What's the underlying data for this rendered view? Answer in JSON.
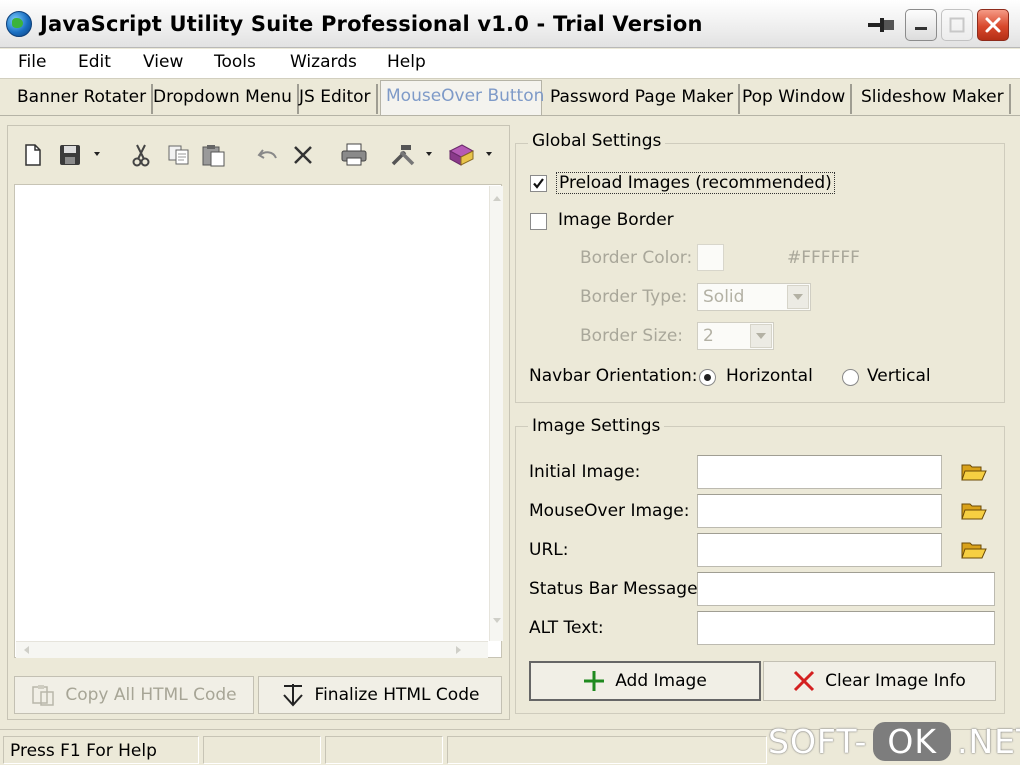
{
  "window": {
    "title": "JavaScript Utility Suite Professional v1.0 - Trial Version"
  },
  "menu": [
    "File",
    "Edit",
    "View",
    "Tools",
    "Wizards",
    "Help"
  ],
  "tabs": [
    {
      "label": "Banner Rotater",
      "active": false
    },
    {
      "label": "Dropdown Menu",
      "active": false
    },
    {
      "label": "JS Editor",
      "active": false
    },
    {
      "label": "MouseOver Button",
      "active": true
    },
    {
      "label": "Password Page Maker",
      "active": false
    },
    {
      "label": "Pop Window",
      "active": false
    },
    {
      "label": "Slideshow Maker",
      "active": false
    }
  ],
  "left": {
    "copy_button": "Copy All HTML Code",
    "finalize_button": "Finalize HTML Code"
  },
  "global_settings": {
    "title": "Global Settings",
    "preload_label": "Preload Images (recommended)",
    "preload_checked": true,
    "border_label": "Image Border",
    "border_checked": false,
    "border_color_label": "Border Color:",
    "border_color_value": "#FFFFFF",
    "border_type_label": "Border Type:",
    "border_type_value": "Solid",
    "border_size_label": "Border Size:",
    "border_size_value": "2",
    "orientation_label": "Navbar Orientation:",
    "orientation_horizontal": "Horizontal",
    "orientation_vertical": "Vertical",
    "orientation_selected": "Horizontal"
  },
  "image_settings": {
    "title": "Image Settings",
    "initial_label": "Initial Image:",
    "initial_value": "",
    "mouseover_label": "MouseOver Image:",
    "mouseover_value": "",
    "url_label": "URL:",
    "url_value": "",
    "status_label": "Status Bar Message:",
    "status_value": "",
    "alt_label": "ALT Text:",
    "alt_value": "",
    "add_button": "Add Image",
    "clear_button": "Clear Image Info"
  },
  "statusbar": {
    "help_text": "Press F1 For Help"
  },
  "watermark": {
    "left": "SOFT-",
    "mid": "OK",
    "right": ".NET"
  },
  "colors": {
    "window_bg": "#ece9d8",
    "active_tab_text": "#7e9ac8",
    "add_icon": "#1f8a1f",
    "clear_icon": "#d42020",
    "close_button": "#d8482c"
  },
  "icons": [
    "globe-app-icon",
    "pin-icon",
    "minimize-icon",
    "maximize-icon",
    "close-icon",
    "new-document-icon",
    "save-icon",
    "cut-icon",
    "copy-icon",
    "paste-icon",
    "undo-icon",
    "delete-icon",
    "print-icon",
    "tools-icon",
    "book-icon",
    "folder-open-icon",
    "plus-icon",
    "x-icon",
    "finalize-arrow-icon",
    "copy-code-icon"
  ]
}
